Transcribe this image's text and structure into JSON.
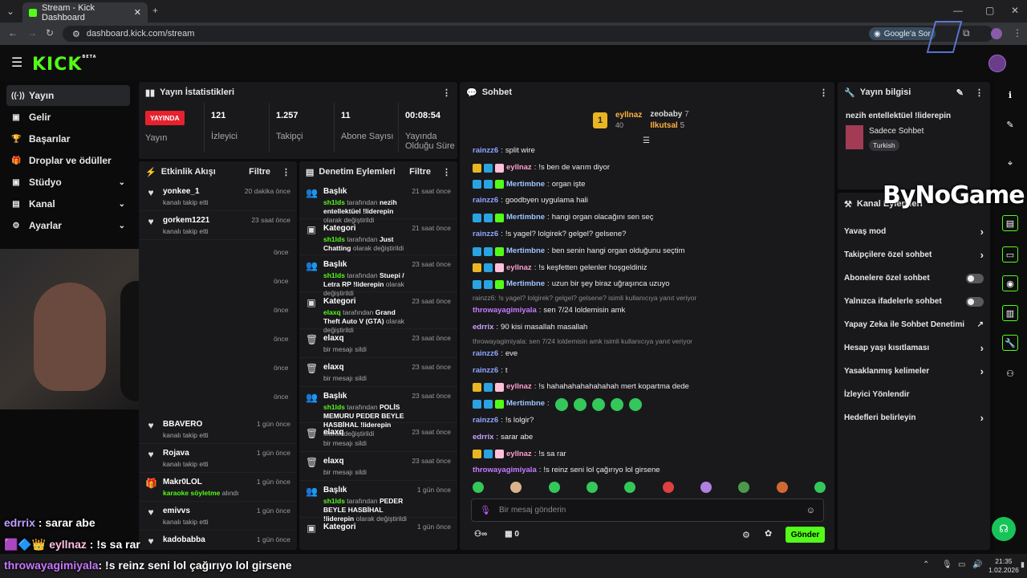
{
  "browser": {
    "tab_title": "Stream - Kick Dashboard",
    "url": "dashboard.kick.com/stream",
    "google_btn": "Google'a Sor"
  },
  "logo": "KICK",
  "logo_badge": "BETA",
  "sidebar": [
    {
      "label": "Yayın",
      "icon": "broadcast-icon",
      "active": true
    },
    {
      "label": "Gelir",
      "icon": "dollar-icon"
    },
    {
      "label": "Başarılar",
      "icon": "trophy-icon"
    },
    {
      "label": "Droplar ve ödüller",
      "icon": "gift-icon"
    },
    {
      "label": "Stüdyo",
      "icon": "studio-icon",
      "chev": true
    },
    {
      "label": "Kanal",
      "icon": "channel-icon",
      "chev": true
    },
    {
      "label": "Ayarlar",
      "icon": "gear-icon",
      "chev": true
    }
  ],
  "stats": {
    "title": "Yayın İstatistikleri",
    "live_badge": "YAYINDA",
    "live_label": "Yayın",
    "items": [
      {
        "v": "121",
        "l": "İzleyici"
      },
      {
        "v": "1.257",
        "l": "Takipçi"
      },
      {
        "v": "11",
        "l": "Abone Sayısı"
      },
      {
        "v": "00:08:54",
        "l": "Yayında Olduğu Süre"
      }
    ]
  },
  "activity": {
    "title": "Etkinlik Akışı",
    "filter": "Filtre",
    "top": [
      {
        "nm": "yonkee_1",
        "sb": "kanalı takip etti",
        "tm": "20 dakika önce"
      },
      {
        "nm": "gorkem1221",
        "sb": "kanalı takip etti",
        "tm": "23 saat önce"
      }
    ],
    "partial_times": [
      "önce",
      "önce",
      "önce",
      "önce",
      "önce",
      "önce"
    ],
    "bottom": [
      {
        "nm": "BBAVERO",
        "sb": "kanalı takip etti",
        "tm": "1 gün önce",
        "icon": "heart-icon"
      },
      {
        "nm": "Rojava",
        "sb": "kanalı takip etti",
        "tm": "1 gün önce",
        "icon": "heart-icon"
      },
      {
        "nm": "Makr0LOL",
        "sb2": "karaoke söyletme",
        "sb3": " alındı",
        "tm": "1 gün önce",
        "icon": "gift-icon"
      },
      {
        "nm": "emivvs",
        "sb": "kanalı takip etti",
        "tm": "1 gün önce",
        "icon": "heart-icon"
      },
      {
        "nm": "kadobabba",
        "sb": "",
        "tm": "1 gün önce",
        "icon": "heart-icon"
      }
    ]
  },
  "moderation": {
    "title": "Denetim Eylemleri",
    "filter": "Filtre",
    "items": [
      {
        "nm": "Başlık",
        "tm": "21 saat önce",
        "who": "sh1lds",
        "mid": " tarafından ",
        "val": "nezih entellektüel !liderepin",
        "end": " olarak değiştirildi",
        "icon": "title-icon"
      },
      {
        "nm": "Kategori",
        "tm": "21 saat önce",
        "who": "sh1lds",
        "mid": " tarafından ",
        "val": "Just Chatting",
        "end": " olarak değiştirildi",
        "icon": "category-icon"
      },
      {
        "nm": "Başlık",
        "tm": "23 saat önce",
        "who": "sh1lds",
        "mid": " tarafından ",
        "val": "Stuepi / Letra RP !liderepin",
        "end": " olarak değiştirildi",
        "icon": "title-icon"
      },
      {
        "nm": "Kategori",
        "tm": "23 saat önce",
        "who": "elaxq",
        "mid": " tarafından ",
        "val": "Grand Theft Auto V (GTA)",
        "end": " olarak değiştirildi",
        "icon": "category-icon"
      },
      {
        "nm": "elaxq",
        "tm": "23 saat önce",
        "plain": "bir mesajı sildi",
        "icon": "trash-icon"
      },
      {
        "nm": "elaxq",
        "tm": "23 saat önce",
        "plain": "bir mesajı sildi",
        "icon": "trash-icon"
      },
      {
        "nm": "Başlık",
        "tm": "23 saat önce",
        "who": "sh1lds",
        "mid": " tarafından ",
        "val": "POLİS MEMURU PEDER BEYLE HASBİHAL !liderepin",
        "end": " olarak değiştirildi",
        "icon": "title-icon"
      },
      {
        "nm": "elaxq",
        "tm": "23 saat önce",
        "plain": "bir mesajı sildi",
        "icon": "trash-icon"
      },
      {
        "nm": "elaxq",
        "tm": "23 saat önce",
        "plain": "bir mesajı sildi",
        "icon": "trash-icon"
      },
      {
        "nm": "Başlık",
        "tm": "1 gün önce",
        "who": "sh1lds",
        "mid": " tarafından ",
        "val": "PEDER BEYLE HASBİHAL !liderepin",
        "end": " olarak değiştirildi",
        "icon": "title-icon"
      },
      {
        "nm": "Kategori",
        "tm": "1 gün önce",
        "icon": "category-icon"
      }
    ]
  },
  "chat": {
    "title": "Sohbet",
    "leader1": {
      "rank": "1",
      "name": "eyllnaz",
      "val": "40"
    },
    "leader2": {
      "name": "zeobaby",
      "val": "7"
    },
    "leader3": {
      "name": "Ilkutsal",
      "val": "5"
    },
    "messages": [
      {
        "u": "rainzz6",
        "c": "u1",
        "t": "split wire",
        "b": 0
      },
      {
        "u": "eyllnaz",
        "c": "u2",
        "t": "!s ben de varım diyor",
        "b": 3
      },
      {
        "u": "Mertimbne",
        "c": "u3",
        "t": "organ işte",
        "b": 2
      },
      {
        "u": "rainzz6",
        "c": "u1",
        "t": "goodbyen uygulama hali",
        "b": 0
      },
      {
        "u": "Mertimbne",
        "c": "u3",
        "t": "hangi organ olacağını sen seç",
        "b": 2
      },
      {
        "u": "rainzz6",
        "c": "u1",
        "t": "!s yagel? lolgirek? gelgel? gelsene?",
        "b": 0
      },
      {
        "u": "Mertimbne",
        "c": "u3",
        "t": "ben senin hangi organ olduğunu seçtim",
        "b": 2
      },
      {
        "u": "eyllnaz",
        "c": "u2",
        "t": "!s keşfetten gelenler hoşgeldiniz",
        "b": 3
      },
      {
        "u": "Mertimbne",
        "c": "u3",
        "t": "uzun bir şey biraz uğraşınca uzuyo",
        "b": 2
      },
      {
        "reply": "rainzz6: !s yagel? lolgirek? gelgel? gelsene? isimli kullanıcıya yanıt veriyor"
      },
      {
        "u": "throwayagimiyala",
        "c": "u5",
        "t": "sen 7/24 loldemisin amk",
        "b": 0
      },
      {
        "u": "edrrix",
        "c": "u4",
        "t": "90 kisi masallah masallah",
        "b": 0
      },
      {
        "reply": "throwayagimiyala: sen 7/24 loldemisin amk isimli kullanıcıya yanıt veriyor"
      },
      {
        "u": "rainzz6",
        "c": "u1",
        "t": "eve",
        "b": 0
      },
      {
        "u": "rainzz6",
        "c": "u1",
        "t": "t",
        "b": 0
      },
      {
        "u": "eyllnaz",
        "c": "u2",
        "t": "!s hahahahahahahahah mert kopartma dede",
        "b": 3
      },
      {
        "u": "Mertimbne",
        "c": "u3",
        "t": "",
        "b": 2,
        "emotes": 5
      },
      {
        "u": "rainzz6",
        "c": "u1",
        "t": "!s lolgir?",
        "b": 0
      },
      {
        "u": "edrrix",
        "c": "u4",
        "t": "sarar abe",
        "b": 0
      },
      {
        "u": "eyllnaz",
        "c": "u2",
        "t": "!s sa rar",
        "b": 3
      },
      {
        "u": "throwayagimiyala",
        "c": "u5",
        "t": "!s reinz seni lol çağırıyo lol girsene",
        "b": 0
      }
    ],
    "placeholder": "Bir mesaj gönderin",
    "send": "Gönder",
    "points": "0"
  },
  "info": {
    "title": "Yayın bilgisi",
    "stream_title": "nezih entellektüel !liderepin",
    "category": "Sadece Sohbet",
    "lang": "Turkish"
  },
  "actions": {
    "title": "Kanal Eylemleri",
    "items": [
      {
        "l": "Yavaş mod",
        "k": "chev"
      },
      {
        "l": "Takipçilere özel sohbet",
        "k": "chev"
      },
      {
        "l": "Abonelere özel sohbet",
        "k": "tog"
      },
      {
        "l": "Yalnızca ifadelerle sohbet",
        "k": "tog"
      },
      {
        "l": "Yapay Zeka ile Sohbet Denetimi",
        "k": "ext"
      },
      {
        "l": "Hesap yaşı kısıtlaması",
        "k": "chev"
      },
      {
        "l": "Yasaklanmış kelimeler",
        "k": "chev"
      },
      {
        "l": "İzleyici Yönlendir",
        "k": ""
      },
      {
        "l": "Hedefleri belirleyin",
        "k": "chev"
      }
    ]
  },
  "overlay": {
    "watermark": "ByNoGame",
    "l1u": "edrrix",
    "l1t": " : sarar abe",
    "l2u": "eyllnaz",
    "l2t": " : !s sa rar",
    "l3u": "throwayagimiyala",
    "l3t": ": !s reinz seni lol çağırıyo lol girsene"
  },
  "taskbar": {
    "time": "21:35",
    "date": "1.02.2026"
  },
  "colors": {
    "kick_green": "#53fc18",
    "live_red": "#e5222e"
  }
}
